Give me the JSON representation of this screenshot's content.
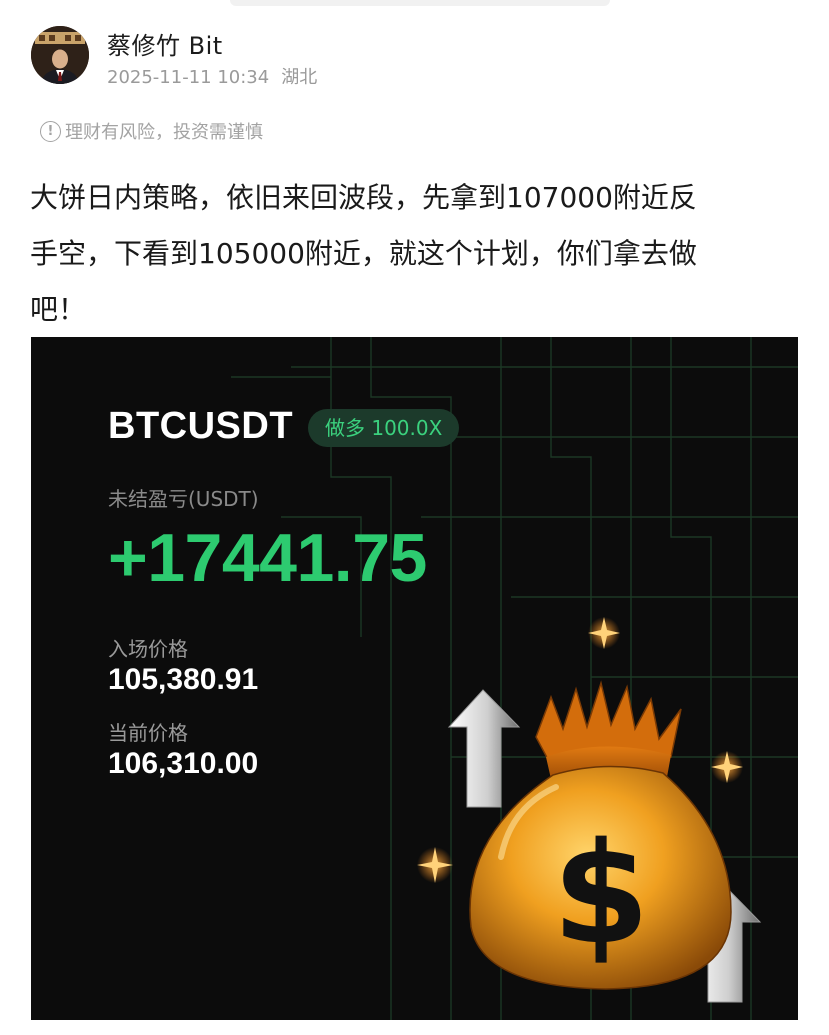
{
  "author": {
    "name": "蔡修竹 Bit",
    "timestamp": "2025-11-11 10:34",
    "location": "湖北"
  },
  "risk_notice": "理财有风险，投资需谨慎",
  "post": {
    "lines": [
      "大饼日内策略，依旧来回波段，先拿到107000附近反",
      "手空，下看到105000附近，就这个计划，你们拿去做",
      "吧！"
    ]
  },
  "trade_card": {
    "symbol": "BTCUSDT",
    "position_badge": "做多 100.0X",
    "pnl_label": "未结盈亏(USDT)",
    "pnl_value": "+17441.75",
    "entry_label": "入场价格",
    "entry_value": "105,380.91",
    "current_label": "当前价格",
    "current_value": "106,310.00",
    "colors": {
      "background": "#0c0c0c",
      "profit_green": "#2dcb70",
      "badge_bg": "#1c3a2b",
      "badge_text": "#3bd17e",
      "grid_line": "#1d3a27",
      "gold": "#f0a020"
    },
    "illustration_icons": [
      "money-bag-icon",
      "up-arrow-icon",
      "sparkle-icon"
    ]
  }
}
